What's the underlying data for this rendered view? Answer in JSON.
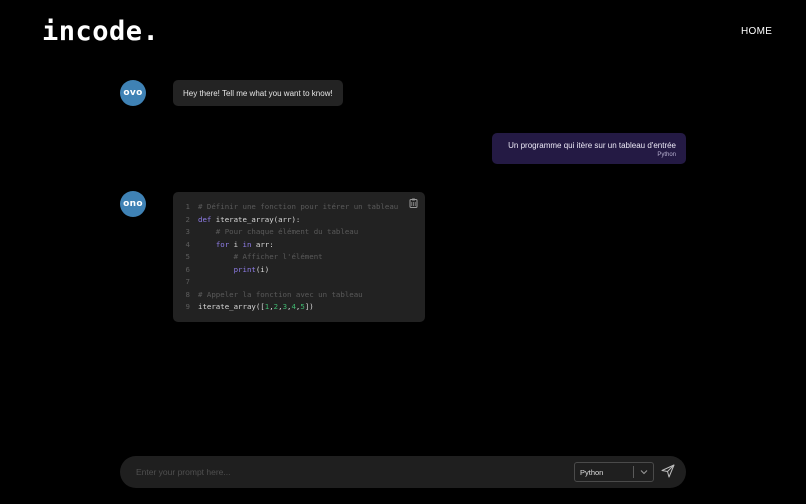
{
  "header": {
    "logo": "incode.",
    "nav_home": "HOME"
  },
  "chat": {
    "bot_avatar_1": "ovo",
    "bot_message": "Hey there! Tell me what you want to know!",
    "user_message": "Un programme qui itère sur un tableau d'entrée",
    "user_language": "Python",
    "bot_avatar_2": "ono",
    "code_lines": [
      {
        "n": "1",
        "text": "# Définir une fonction pour itérer un tableau"
      },
      {
        "n": "2",
        "kw": "def",
        "text": " iterate_array(arr):"
      },
      {
        "n": "3",
        "text": "    # Pour chaque élément du tableau"
      },
      {
        "n": "4",
        "indent": "    ",
        "kw": "for",
        "a": " i ",
        "kw2": "in",
        "b": " arr:"
      },
      {
        "n": "5",
        "text": "        # Afficher l'élément"
      },
      {
        "n": "6",
        "indent": "        ",
        "kw": "print",
        "b": "(i)"
      },
      {
        "n": "7",
        "text": ""
      },
      {
        "n": "8",
        "text": "# Appeler la fonction avec un tableau"
      },
      {
        "n": "9",
        "a": "iterate_array([",
        "nums": [
          "1",
          "2",
          "3",
          "4",
          "5"
        ],
        "b": "])"
      }
    ]
  },
  "prompt": {
    "placeholder": "Enter your prompt here...",
    "value": "",
    "language_selected": "Python"
  },
  "icons": {
    "copy": "clipboard-icon",
    "dropdown": "chevron-down-icon",
    "send": "send-icon"
  },
  "colors": {
    "background": "#000000",
    "avatar": "#3f82b5",
    "bot_bubble": "#232323",
    "user_bubble": "#241a44",
    "code_bg": "#222222",
    "keyword": "#8f7de8",
    "number": "#3fb870",
    "comment": "#5a5a5a"
  }
}
